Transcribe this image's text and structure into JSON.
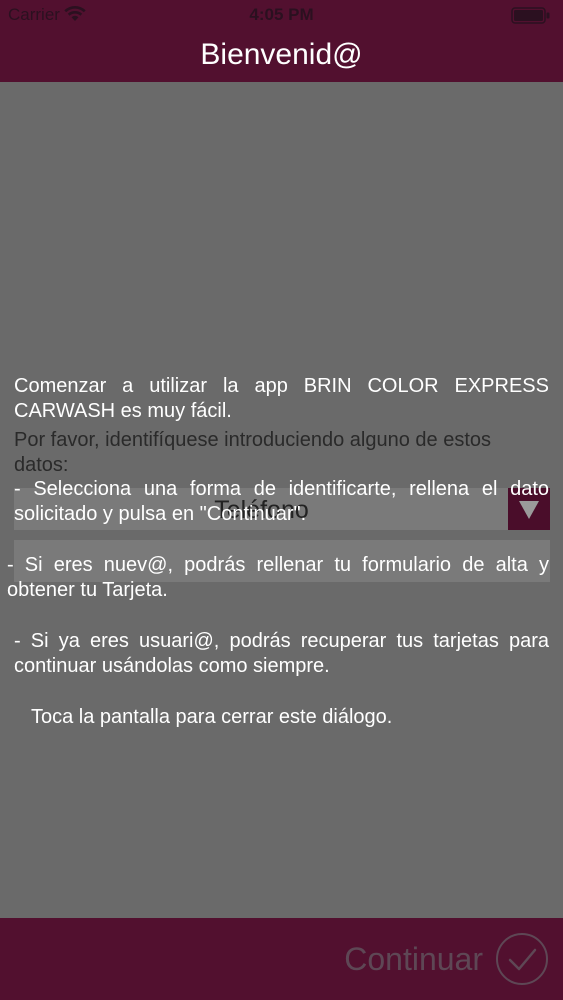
{
  "status_bar": {
    "carrier": "Carrier",
    "time": "4:05 PM",
    "wifi_icon": "wifi-icon",
    "battery_icon": "battery-icon"
  },
  "header": {
    "title": "Bienvenid@"
  },
  "form": {
    "intro": "Por favor, identifíquese introduciendo alguno de estos datos:",
    "id_type_value": "Teléfono",
    "dropdown_icon": "triangle-down-icon"
  },
  "dialog": {
    "intro": "Comenzar a utilizar la app BRIN COLOR EXPRESS CARWASH es muy fácil.",
    "step1": " - Selecciona una forma de identificarte, rellena el dato solicitado y pulsa en \"Continuar\".",
    "new_user": " - Si eres nuev@, podrás rellenar tu formulario de alta y obtener tu Tarjeta.",
    "existing_user": " - Si ya eres usuari@, podrás recuperar tus tarjetas para continuar usándolas como siempre.",
    "close_hint": "Toca la pantalla para cerrar este diálogo."
  },
  "footer": {
    "continue_label": "Continuar",
    "continue_icon": "check-circle-icon"
  },
  "colors": {
    "bar_background": "#52102f",
    "overlay_background": "#6a6a6a",
    "text_white": "#ffffff"
  }
}
